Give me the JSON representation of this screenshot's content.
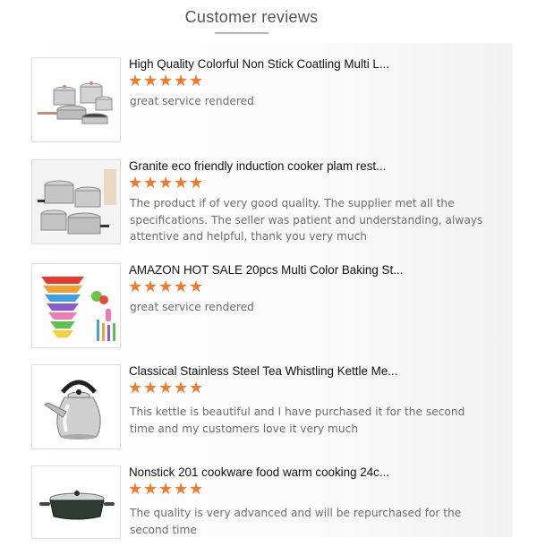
{
  "header": {
    "title": "Customer reviews"
  },
  "reviews": [
    {
      "title": "High Quality Colorful Non Stick Coatling Multi L...",
      "stars": 5,
      "comment": "great service rendered",
      "image": "cookware-set-image"
    },
    {
      "title": "Granite eco friendly induction cooker plam rest...",
      "stars": 5,
      "comment": "The product if of very good quality. The supplier met all the specifications. The seller was patient and understanding, always attentive and helpful, thank you very much",
      "image": "stainless-pots-image"
    },
    {
      "title": "AMAZON HOT SALE 20pcs Multi Color Baking St...",
      "stars": 5,
      "comment": "great service rendered",
      "image": "mixing-bowls-image"
    },
    {
      "title": "Classical Stainless Steel Tea Whistling Kettle Me...",
      "stars": 5,
      "comment": "This kettle is beautiful and I have purchased it for the second time and my customers love it very much",
      "image": "tea-kettle-image"
    },
    {
      "title": "Nonstick 201 cookware food warm cooking 24c...",
      "stars": 5,
      "comment": "The quality is very advanced and will be repurchased for the second time",
      "image": "casserole-pot-image"
    }
  ],
  "colors": {
    "star": "#f27a2a",
    "title": "#111111",
    "comment": "#6d6d6d"
  },
  "icons": {
    "star": "star-icon"
  }
}
